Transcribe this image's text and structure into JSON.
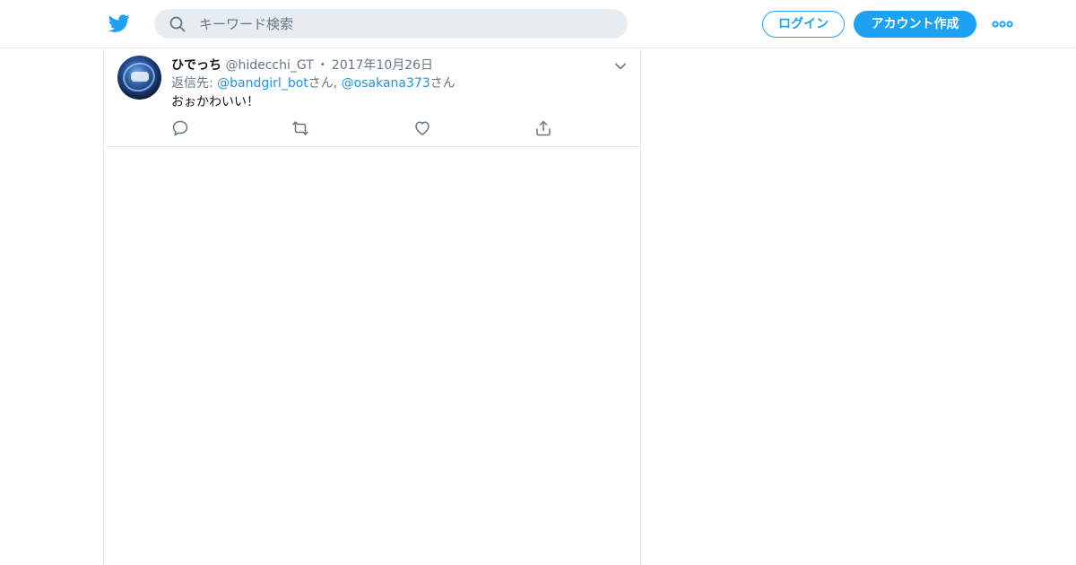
{
  "header": {
    "logo_icon": "twitter-bird-icon",
    "search": {
      "placeholder": "キーワード検索",
      "value": "",
      "icon": "search-icon"
    },
    "login_label": "ログイン",
    "signup_label": "アカウント作成",
    "more_icon": "more-dots-icon"
  },
  "tweet": {
    "author_name": "ひでっち",
    "author_handle": "@hidecchi_GT",
    "separator": "・",
    "date": "2017年10月26日",
    "reply_prefix": "返信先: ",
    "reply_to": [
      {
        "handle": "@bandgirl_bot",
        "suffix": "さん"
      },
      {
        "handle": "@osakana373",
        "suffix": "さん"
      }
    ],
    "reply_separator": ", ",
    "text": "おぉかわいい！",
    "actions": [
      "reply-icon",
      "retweet-icon",
      "like-icon",
      "share-icon"
    ]
  },
  "colors": {
    "accent": "#1da1f2",
    "link": "#1b95e0",
    "muted": "#657786",
    "search_bg": "#e6ecf0",
    "border": "#e6ecf0",
    "text": "#14171a"
  }
}
